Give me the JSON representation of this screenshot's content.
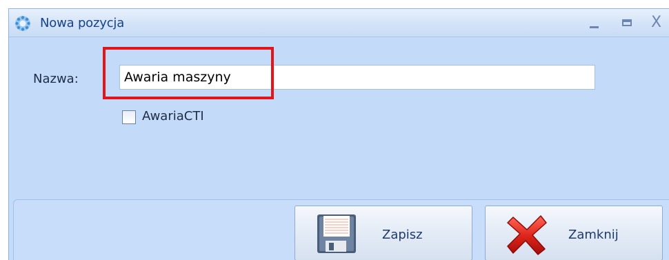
{
  "window": {
    "title": "Nowa pozycja",
    "controls": {
      "minimize": "_",
      "maximize": "□",
      "close": "X"
    }
  },
  "form": {
    "name_label": "Nazwa:",
    "name_value": "Awaria maszyny",
    "checkbox_label": "AwariaCTI",
    "checkbox_checked": false
  },
  "buttons": {
    "save_label": "Zapisz",
    "save_icon": "floppy-disk-icon",
    "close_label": "Zamknij",
    "close_icon": "red-x-icon"
  },
  "colors": {
    "window_bg": "#c3daf9",
    "title_text": "#15428b",
    "highlight": "#e3141a"
  }
}
